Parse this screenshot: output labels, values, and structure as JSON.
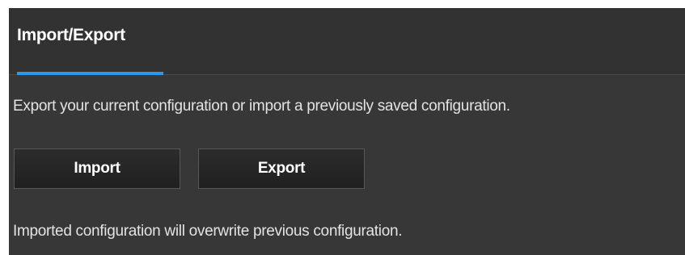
{
  "header": {
    "title": "Import/Export"
  },
  "content": {
    "description": "Export your current configuration or import a previously saved configuration.",
    "import_label": "Import",
    "export_label": "Export",
    "note": "Imported configuration will overwrite previous configuration."
  },
  "colors": {
    "accent": "#2f97e6",
    "panel_bg": "#373737",
    "header_bg": "#323232",
    "button_bg": "#262626",
    "text": "#e3e3e3"
  }
}
